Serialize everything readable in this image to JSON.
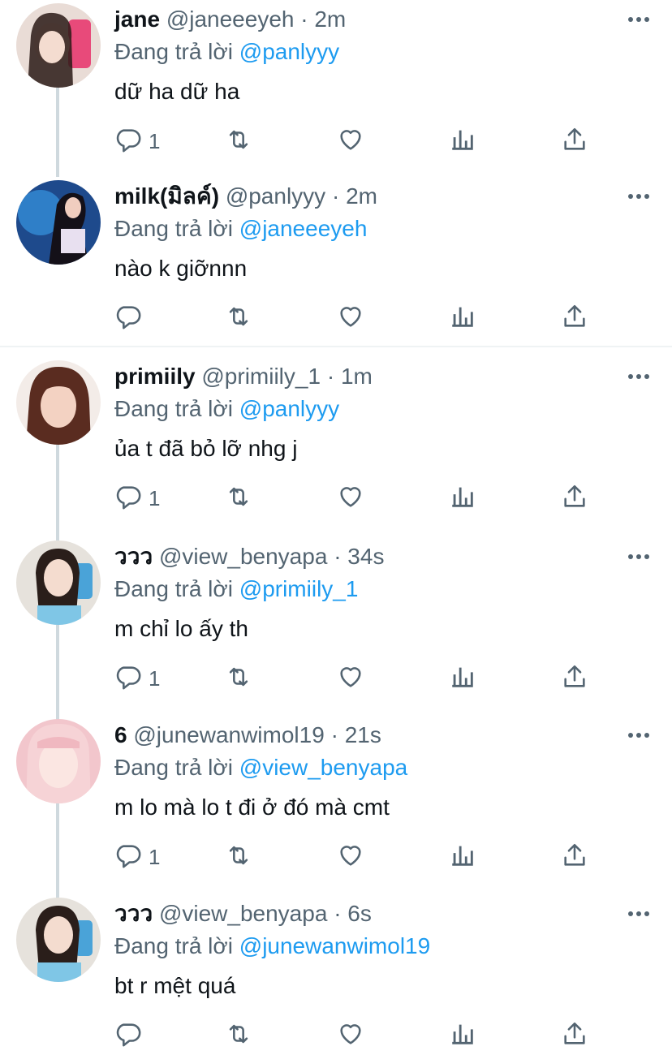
{
  "replying_prefix": "Đang trả lời",
  "colors": {
    "text": "#0f1419",
    "secondary": "#536471",
    "link": "#1d9bf0",
    "line": "#cfd9de"
  },
  "tweets": [
    {
      "name": "jane",
      "handle": "@janeeeyeh",
      "dot": "·",
      "time": "2m",
      "reply_to": "@panlyyy",
      "text": "dữ ha dữ ha",
      "reply_count": "1",
      "avatar": "avatar-jane"
    },
    {
      "name": "milk(มิลค์)",
      "handle": "@panlyyy",
      "dot": "·",
      "time": "2m",
      "reply_to": "@janeeeyeh",
      "text": "nào k giỡnnn",
      "reply_count": "",
      "avatar": "avatar-milk"
    },
    {
      "name": "primiily",
      "handle": "@primiily_1",
      "dot": "·",
      "time": "1m",
      "reply_to": "@panlyyy",
      "text": "ủa t đã bỏ lỡ nhg j",
      "reply_count": "1",
      "avatar": "avatar-primiily"
    },
    {
      "name": "ววว",
      "handle": "@view_benyapa",
      "dot": "·",
      "time": "34s",
      "reply_to": "@primiily_1",
      "text": "m chỉ lo ấy th",
      "reply_count": "1",
      "avatar": "avatar-view"
    },
    {
      "name": "6",
      "handle": "@junewanwimol19",
      "dot": "·",
      "time": "21s",
      "reply_to": "@view_benyapa",
      "text": "m lo mà lo t đi ở đó mà cmt",
      "reply_count": "1",
      "avatar": "avatar-june"
    },
    {
      "name": "ววว",
      "handle": "@view_benyapa",
      "dot": "·",
      "time": "6s",
      "reply_to": "@junewanwimol19",
      "text": "bt r mệt quá",
      "reply_count": "",
      "avatar": "avatar-view"
    }
  ]
}
